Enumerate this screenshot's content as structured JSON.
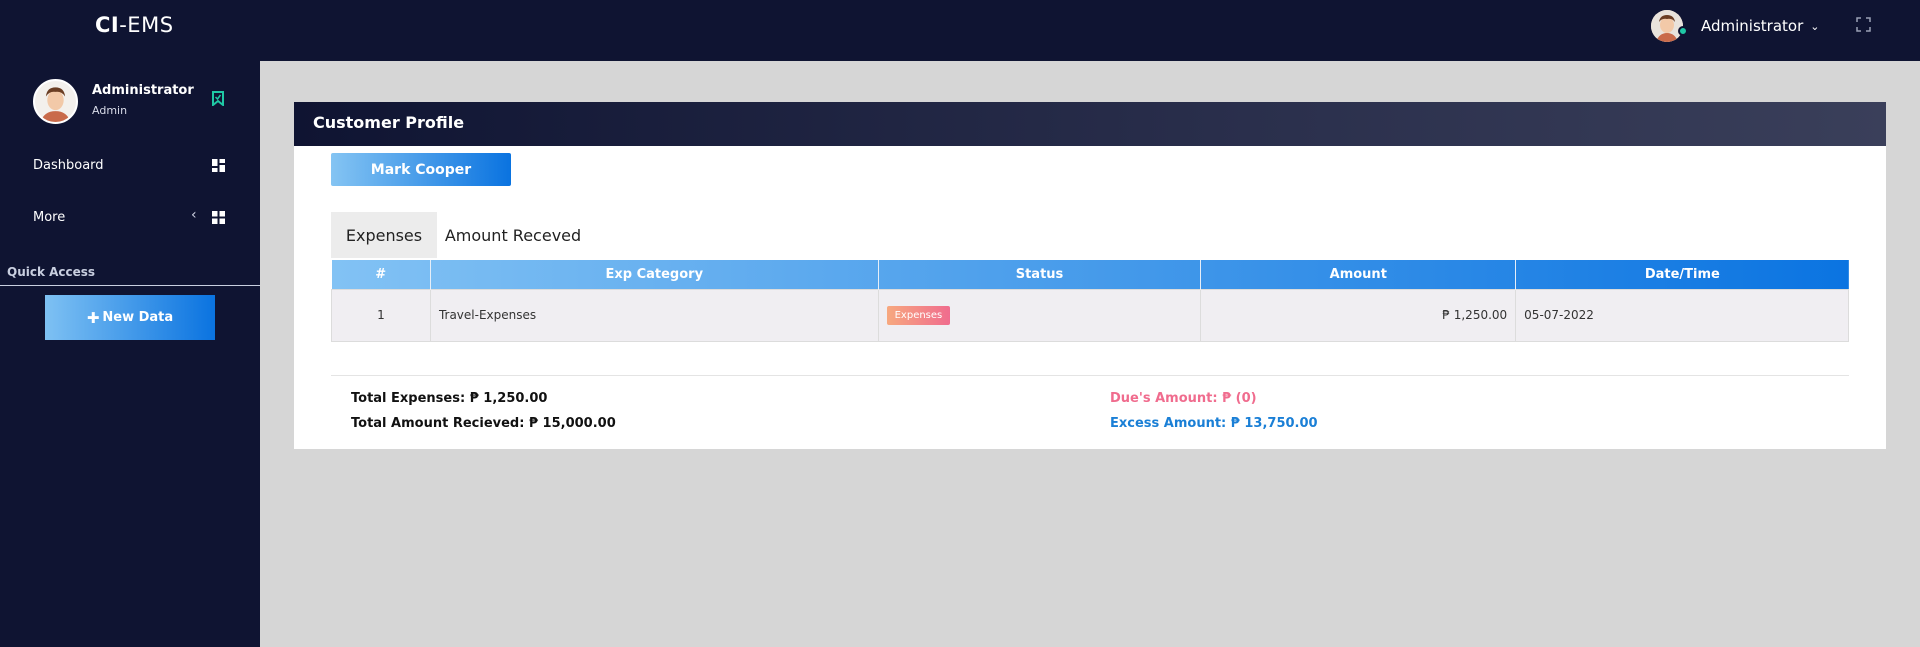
{
  "topbar": {
    "brand_prefix": "CI",
    "brand_suffix": "-EMS",
    "user_name": "Administrator",
    "chevron": "⌄"
  },
  "sidebar": {
    "profile": {
      "name": "Administrator",
      "role": "Admin"
    },
    "items": [
      {
        "label": "Dashboard",
        "icon": "dashboard-icon"
      },
      {
        "label": "More",
        "icon": "grid-icon",
        "caret": "‹"
      }
    ],
    "quick_access_label": "Quick Access",
    "new_data_label": "New Data"
  },
  "colors": {
    "dark_navy": "#0f1432",
    "accent_blue": "#0a73e0",
    "light_blue": "#82c2f4",
    "due_color": "#f06c8e",
    "excess_color": "#1a7fd6",
    "online": "#1fc8a5"
  },
  "main": {
    "title": "Customer Profile",
    "customer_name": "Mark Cooper",
    "tabs": [
      {
        "label": "Expenses",
        "active": true
      },
      {
        "label": "Amount Receved",
        "active": false
      }
    ],
    "table": {
      "headers": [
        "#",
        "Exp Category",
        "Status",
        "Amount",
        "Date/Time"
      ],
      "rows": [
        {
          "num": "1",
          "category": "Travel-Expenses",
          "status": "Expenses",
          "amount": "₱ 1,250.00",
          "datetime": "05-07-2022"
        }
      ]
    },
    "summary": {
      "total_expenses_label": "Total Expenses:",
      "total_expenses_value": "₱ 1,250.00",
      "total_received_label": "Total Amount Recieved:",
      "total_received_value": "₱ 15,000.00",
      "due_label": "Due's Amount:",
      "due_value": "₱ (0)",
      "excess_label": "Excess Amount:",
      "excess_value": "₱ 13,750.00"
    }
  }
}
